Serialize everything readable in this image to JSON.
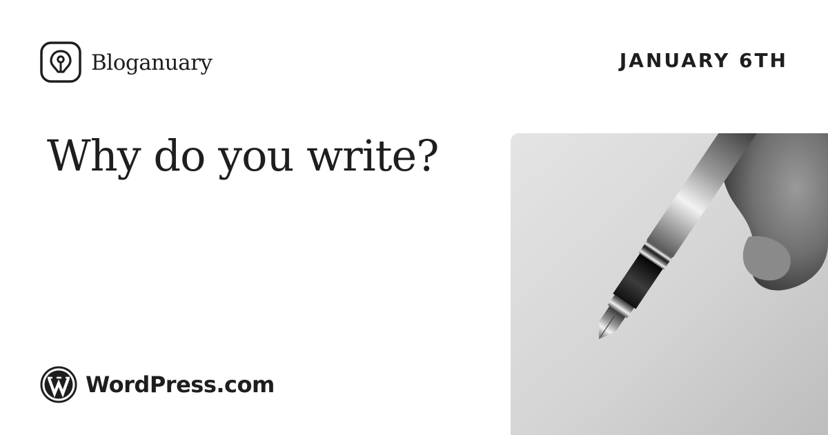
{
  "brand": {
    "name": "Bloganuary",
    "icon": "bloganuary-pen-nib-icon"
  },
  "date": "JANUARY 6TH",
  "prompt": "Why do you write?",
  "footer": {
    "logo_text": "WordPress.com",
    "icon": "wordpress-icon"
  },
  "photo": {
    "subject": "fountain-pen-photo"
  },
  "colors": {
    "background": "#ffffff",
    "text": "#1e1e1e"
  }
}
